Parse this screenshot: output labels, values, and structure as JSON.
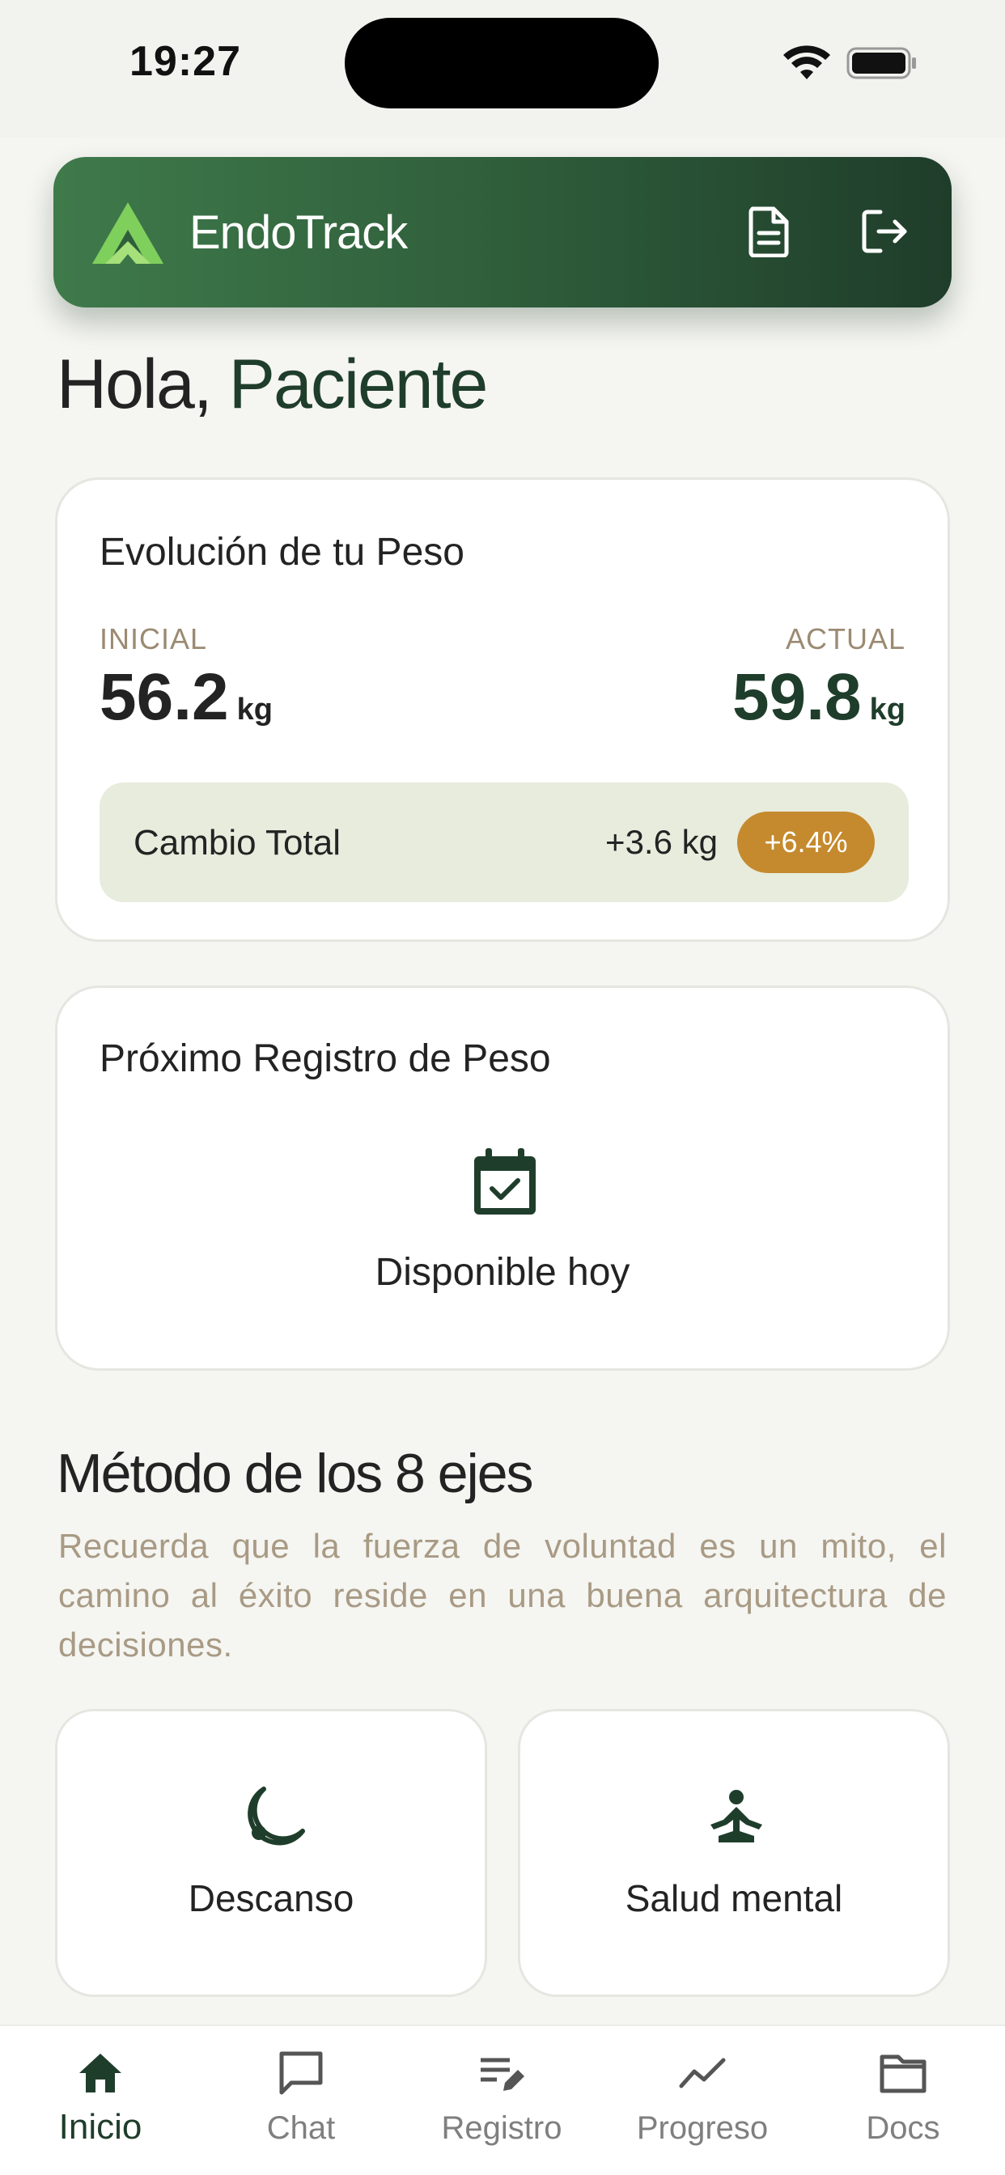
{
  "status_bar": {
    "time": "19:27"
  },
  "header": {
    "app_title": "EndoTrack",
    "logo_icon": "endotrack-logo",
    "colors": {
      "gradient_start": "#3f7a4b",
      "gradient_end": "#1f3d2a"
    }
  },
  "greeting": {
    "prefix": "Hola, ",
    "name": "Paciente"
  },
  "weight_card": {
    "title": "Evolución de tu Peso",
    "initial_label": "INICIAL",
    "initial_value": "56.2",
    "current_label": "ACTUAL",
    "current_value": "59.8",
    "unit": "kg",
    "change_label": "Cambio Total",
    "change_value": "+3.6 kg",
    "change_percent": "+6.4%"
  },
  "next_card": {
    "title": "Próximo Registro de Peso",
    "icon": "calendar-check-icon",
    "status": "Disponible hoy"
  },
  "method": {
    "title": "Método de los 8 ejes",
    "description": "Recuerda que la fuerza de voluntad es un mito, el camino al éxito reside en una buena arquitectura de decisiones.",
    "axes": [
      {
        "label": "Descanso",
        "icon": "moon-icon"
      },
      {
        "label": "Salud mental",
        "icon": "meditation-icon"
      }
    ]
  },
  "nav": {
    "active": "Inicio",
    "items": [
      {
        "label": "Inicio",
        "icon": "home-icon"
      },
      {
        "label": "Chat",
        "icon": "chat-icon"
      },
      {
        "label": "Registro",
        "icon": "edit-note-icon"
      },
      {
        "label": "Progreso",
        "icon": "trend-icon"
      },
      {
        "label": "Docs",
        "icon": "folder-icon"
      }
    ]
  },
  "colors": {
    "accent_green": "#1f3d2b",
    "badge_gold": "#c58a2e",
    "muted_tan": "#9b8a72"
  }
}
